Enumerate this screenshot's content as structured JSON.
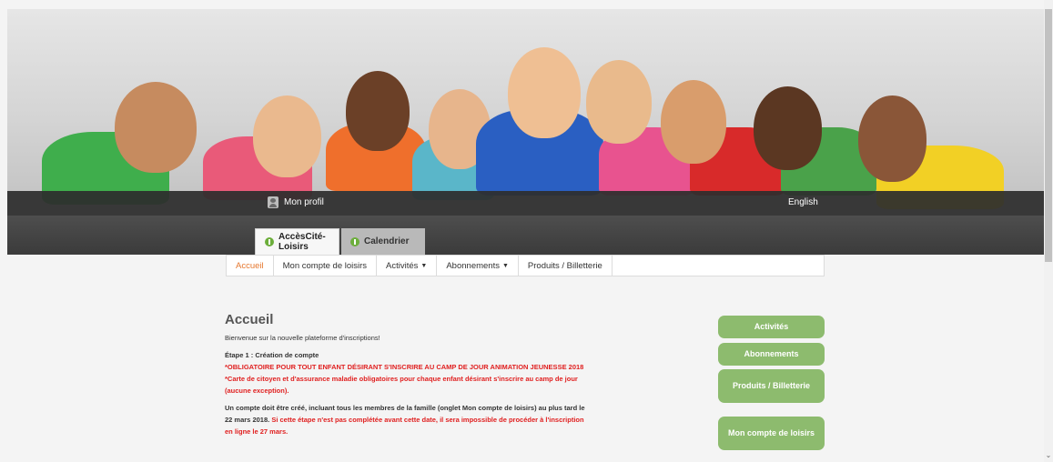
{
  "header": {
    "profile_label": "Mon profil",
    "language_label": "English"
  },
  "tabs": [
    {
      "label": "AccèsCité-Loisirs",
      "active": true
    },
    {
      "label": "Calendrier",
      "active": false
    }
  ],
  "subnav": [
    {
      "label": "Accueil",
      "active": true,
      "dropdown": false
    },
    {
      "label": "Mon compte de loisirs",
      "active": false,
      "dropdown": false
    },
    {
      "label": "Activités",
      "active": false,
      "dropdown": true
    },
    {
      "label": "Abonnements",
      "active": false,
      "dropdown": true
    },
    {
      "label": "Produits / Billetterie",
      "active": false,
      "dropdown": false
    }
  ],
  "main": {
    "title": "Accueil",
    "welcome": "Bienvenue sur la nouvelle plateforme d'inscriptions!",
    "step1_title": "Étape 1 : Création de compte",
    "step1_mandatory": "*OBLIGATOIRE POUR TOUT ENFANT DÉSIRANT S'INSCRIRE AU CAMP DE JOUR ANIMATION JEUNESSE 2018",
    "step1_card_note": "*Carte de citoyen et d'assurance maladie obligatoires pour chaque enfant désirant s'inscrire au camp de jour (aucune exception).",
    "account_text": "Un compte doit être créé, incluant tous les membres de la famille (onglet Mon compte de loisirs) au plus tard le 22 mars 2018.",
    "account_warning": "Si cette étape n'est pas complétée avant cette date, il sera impossible de procéder à l'inscription en ligne le 27 mars."
  },
  "sidebar_buttons": [
    {
      "label": "Activités"
    },
    {
      "label": "Abonnements"
    },
    {
      "label": "Produits / Billetterie"
    },
    {
      "label": "Mon compte de loisirs"
    }
  ],
  "colors": {
    "accent_green": "#8dbb6e",
    "active_nav": "#e6782f",
    "warning_red": "#e02020"
  }
}
